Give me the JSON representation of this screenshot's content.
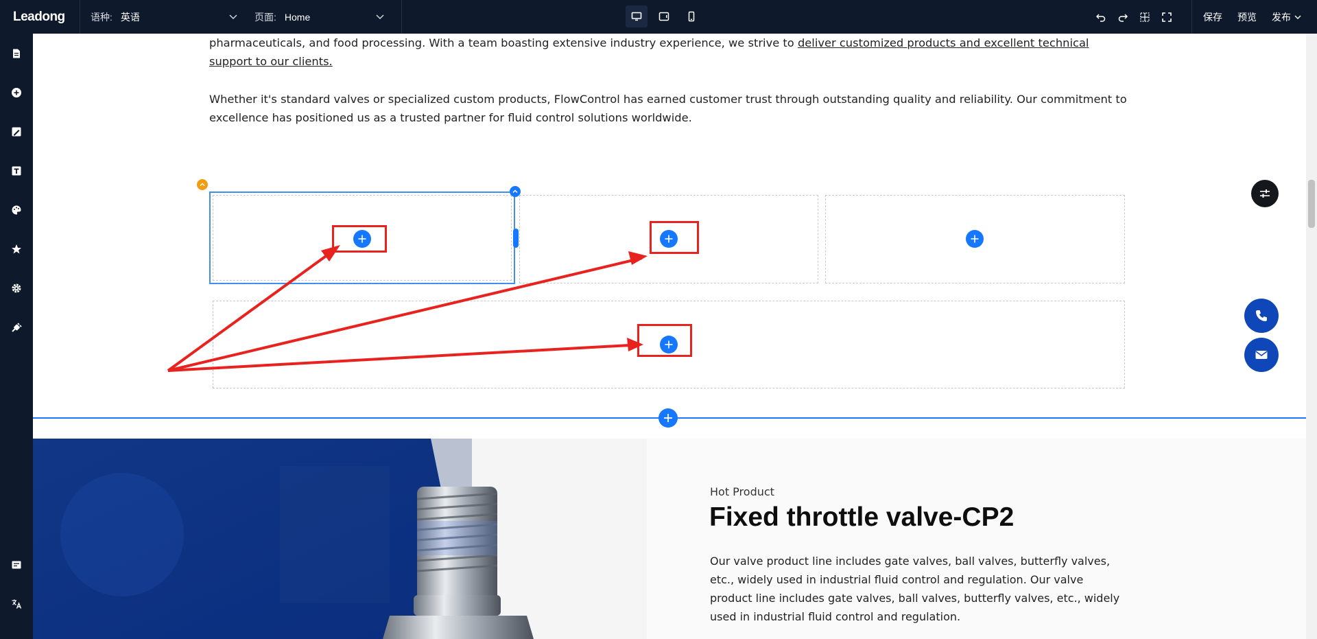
{
  "app": {
    "logo": "Leadong"
  },
  "topbar": {
    "language_label": "语种:",
    "language_value": "英语",
    "page_label": "页面:",
    "page_value": "Home",
    "save": "保存",
    "preview": "预览",
    "publish": "发布"
  },
  "content": {
    "para1_line1_a": "pharmaceuticals, and food processing. With a team boasting extensive industry experience, we strive to ",
    "para1_link": "deliver customized products and excellent technical support to our clients.",
    "para2": "Whether it's standard valves or specialized custom products, FlowControl has earned customer trust through outstanding quality and reliability. Our commitment to excellence has positioned us as a trusted partner for fluid control solutions worldwide.",
    "hot_label": "Hot Product",
    "product_title": "Fixed throttle valve-CP2",
    "product_desc": "Our valve product line includes gate valves, ball valves, butterfly valves, etc., widely used in industrial fluid control and regulation. Our valve product line includes gate valves, ball valves, butterfly valves, etc., widely used in industrial fluid control and regulation."
  },
  "colors": {
    "topbar": "#0e1a2c",
    "accent": "#1677ff",
    "annotation_red": "#e8231f",
    "fab_blue": "#0f47b8"
  },
  "icons": [
    "desktop-icon",
    "tablet-icon",
    "mobile-icon",
    "undo-icon",
    "redo-icon",
    "grid-icon",
    "fullscreen-icon",
    "page-icon",
    "add-circle-icon",
    "edit-image-icon",
    "text-icon",
    "palette-icon",
    "star-icon",
    "gear-icon",
    "plugin-icon",
    "form-icon",
    "translate-icon",
    "folder-icon",
    "phone-icon",
    "mail-icon",
    "sliders-icon"
  ]
}
